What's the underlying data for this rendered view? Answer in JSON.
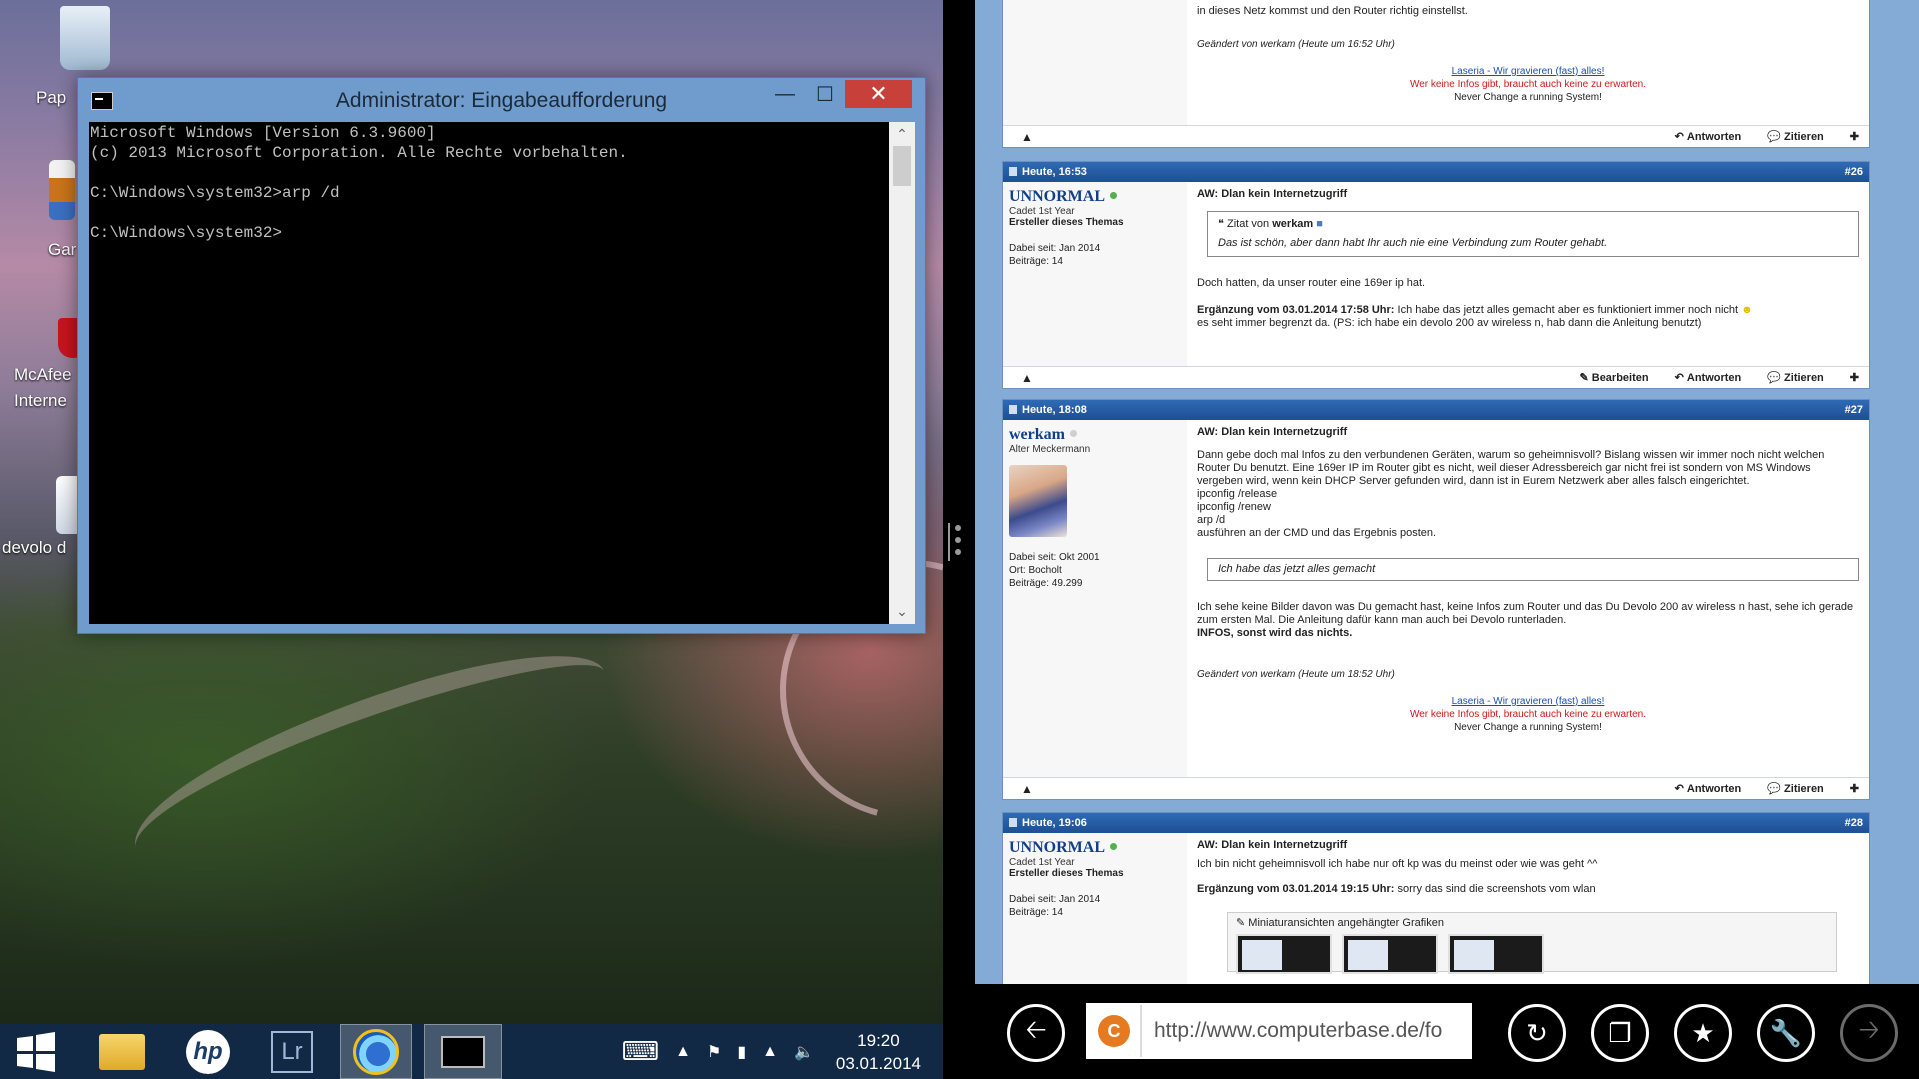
{
  "desktop": {
    "icons": [
      {
        "label": "Pap"
      },
      {
        "label": "Gar"
      },
      {
        "label": "McAfee Interne"
      },
      {
        "label": "devolo d"
      }
    ]
  },
  "taskbar": {
    "apps": [
      "windows-start",
      "file-explorer",
      "hp",
      "lightroom",
      "ie",
      "cmd"
    ],
    "lightroom_label": "Lr",
    "hp_label": "hp",
    "time": "19:20",
    "date": "03.01.2014"
  },
  "cmd": {
    "title": "Administrator: Eingabeaufforderung",
    "lines": "Microsoft Windows [Version 6.3.9600]\n(c) 2013 Microsoft Corporation. Alle Rechte vorbehalten.\n\nC:\\Windows\\system32>arp /d\n\nC:\\Windows\\system32>"
  },
  "browser": {
    "url": "http://www.computerbase.de/fo",
    "post25": {
      "text_top": "in dieses Netz kommst und den Router richtig einstellst.",
      "edited": "Geändert von werkam (Heute um 16:52 Uhr)",
      "sig1": "Laseria - Wir gravieren (fast) alles!",
      "sig2": "Wer keine Infos gibt, braucht auch keine zu erwarten.",
      "sig3": "Never Change a running System!"
    },
    "actions": {
      "edit": "Bearbeiten",
      "reply": "Antworten",
      "quote": "Zitieren"
    },
    "post26": {
      "date": "Heute, 16:53",
      "num": "#26",
      "user": "UNNORMAL",
      "rank": "Cadet 1st Year",
      "starter": "Ersteller dieses Themas",
      "joined": "Dabei seit: Jan 2014",
      "posts": "Beiträge: 14",
      "title": "AW: Dlan kein Internetzugriff",
      "quote_from": "Zitat von",
      "quote_user": "werkam",
      "quote_text": "Das ist schön, aber dann habt Ihr auch nie eine Verbindung zum Router gehabt.",
      "text1": "Doch hatten, da unser router eine 169er ip hat.",
      "add_label": "Ergänzung vom 03.01.2014 17:58 Uhr:",
      "add_text": " Ich habe das jetzt alles gemacht aber es funktioniert immer noch nicht",
      "add_text2": "es seht immer begrenzt da. (PS: ich habe ein devolo 200 av wireless n, hab dann die Anleitung benutzt)"
    },
    "post27": {
      "date": "Heute, 18:08",
      "num": "#27",
      "user": "werkam",
      "rank": "Alter Meckermann",
      "joined": "Dabei seit: Okt 2001",
      "location": "Ort: Bocholt",
      "posts": "Beiträge: 49.299",
      "title": "AW: Dlan kein Internetzugriff",
      "p1": "Dann gebe doch mal Infos zu den verbundenen Geräten, warum so geheimnisvoll? Bislang wissen wir immer noch nicht welchen Router Du benutzt. Eine 169er IP im Router gibt es nicht, weil dieser Adressbereich gar nicht frei ist sondern von MS Windows vergeben wird, wenn kein DHCP Server gefunden wird, dann ist in Eurem Netzwerk aber alles falsch eingerichtet.",
      "c1": "ipconfig /release",
      "c2": "ipconfig /renew",
      "c3": "arp /d",
      "p2": "ausführen an der CMD und das Ergebnis posten.",
      "quote_text": "Ich habe das jetzt alles gemacht",
      "p3": "Ich sehe keine Bilder davon was Du gemacht hast, keine Infos zum Router und das Du Devolo 200 av wireless n hast, sehe ich gerade zum ersten Mal. Die Anleitung dafür kann man auch bei Devolo runterladen.",
      "p4": "INFOS, sonst wird das nichts.",
      "edited": "Geändert von werkam (Heute um 18:52 Uhr)"
    },
    "post28": {
      "date": "Heute, 19:06",
      "num": "#28",
      "user": "UNNORMAL",
      "rank": "Cadet 1st Year",
      "starter": "Ersteller dieses Themas",
      "joined": "Dabei seit: Jan 2014",
      "posts": "Beiträge: 14",
      "title": "AW: Dlan kein Internetzugriff",
      "text1": "Ich bin nicht geheimnisvoll ich habe nur oft kp was du meinst oder wie was geht ^^",
      "add_label": "Ergänzung vom 03.01.2014 19:15 Uhr:",
      "add_text": " sorry das sind die screenshots vom wlan",
      "attach_label": "Miniaturansichten angehängter Grafiken"
    }
  }
}
